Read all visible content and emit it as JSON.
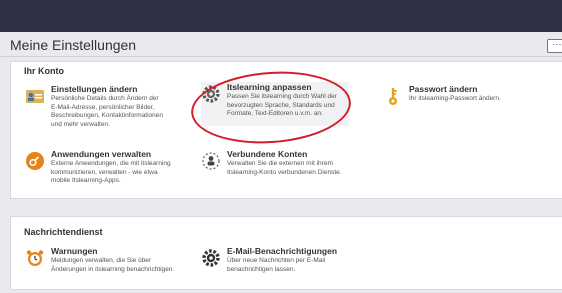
{
  "page": {
    "title": "Meine Einstellungen",
    "more_label": "···"
  },
  "konto": {
    "section_title": "Ihr Konto",
    "items": [
      {
        "title": "Einstellungen ändern",
        "lines": [
          "Persönliche Details durch Ändern der",
          "E-Mail-Adresse, persönlicher Bilder,",
          "Beschreibungen, Kontaktinformationen",
          "und mehr verwalten."
        ],
        "icon": "settings-card-icon"
      },
      {
        "title": "Itslearning anpassen",
        "lines": [
          "Passen Sie itslearning durch Wahl der",
          "bevorzugten Sprache, Standards und",
          "Formate, Text-Editoren u.v.m. an."
        ],
        "icon": "gear-icon"
      },
      {
        "title": "Passwort ändern",
        "lines": [
          "Ihr itslearning-Passwort ändern."
        ],
        "icon": "key-icon"
      },
      {
        "title": "Anwendungen verwalten",
        "lines": [
          "Externe Anwendungen, die mit itslearning",
          "kommunizieren, verwalten - wie etwa",
          "mobile Itslearning-Apps."
        ],
        "icon": "apps-icon"
      },
      {
        "title": "Verbundene Konten",
        "lines": [
          "Verwalten Sie die externen mit ihrem",
          "Itslearning-Konto verbundenen Dienste."
        ],
        "icon": "connected-accounts-icon"
      }
    ]
  },
  "nachricht": {
    "section_title": "Nachrichtendienst",
    "items": [
      {
        "title": "Warnungen",
        "lines": [
          "Meldungen verwalten, die Sie über",
          "Änderungen in itslearning benachrichtigen."
        ],
        "icon": "alarm-clock-icon"
      },
      {
        "title": "E-Mail-Benachrichtigungen",
        "lines": [
          "Über neue Nachrichten per E-Mail",
          "benachrichtigen lassen."
        ],
        "icon": "gear-icon"
      }
    ]
  },
  "colors": {
    "topbar": "#2f3046",
    "highlight_circle": "#d11e2a",
    "accent_orange": "#e5841a"
  }
}
